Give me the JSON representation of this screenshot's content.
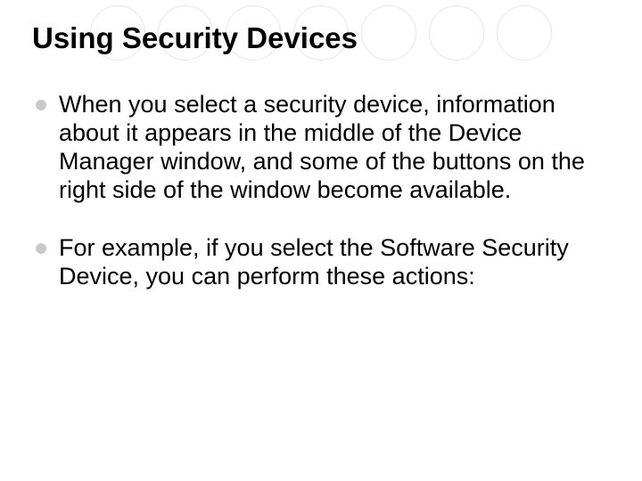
{
  "slide": {
    "title": "Using Security Devices",
    "bullets": [
      "When you select a security device, information about it appears in the middle of the Device Manager window, and some of the buttons on the right side of the window become available.",
      "For example, if you select the Software Security Device, you can perform these actions:"
    ]
  }
}
